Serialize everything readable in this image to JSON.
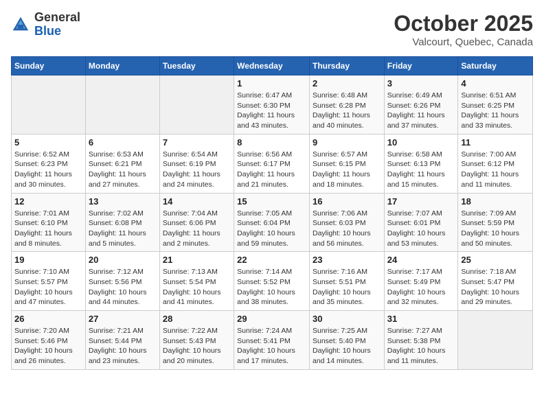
{
  "header": {
    "logo_general": "General",
    "logo_blue": "Blue",
    "month_title": "October 2025",
    "subtitle": "Valcourt, Quebec, Canada"
  },
  "weekdays": [
    "Sunday",
    "Monday",
    "Tuesday",
    "Wednesday",
    "Thursday",
    "Friday",
    "Saturday"
  ],
  "weeks": [
    [
      {
        "day": "",
        "empty": true
      },
      {
        "day": "",
        "empty": true
      },
      {
        "day": "",
        "empty": true
      },
      {
        "day": "1",
        "sunrise": "Sunrise: 6:47 AM",
        "sunset": "Sunset: 6:30 PM",
        "daylight": "Daylight: 11 hours and 43 minutes."
      },
      {
        "day": "2",
        "sunrise": "Sunrise: 6:48 AM",
        "sunset": "Sunset: 6:28 PM",
        "daylight": "Daylight: 11 hours and 40 minutes."
      },
      {
        "day": "3",
        "sunrise": "Sunrise: 6:49 AM",
        "sunset": "Sunset: 6:26 PM",
        "daylight": "Daylight: 11 hours and 37 minutes."
      },
      {
        "day": "4",
        "sunrise": "Sunrise: 6:51 AM",
        "sunset": "Sunset: 6:25 PM",
        "daylight": "Daylight: 11 hours and 33 minutes."
      }
    ],
    [
      {
        "day": "5",
        "sunrise": "Sunrise: 6:52 AM",
        "sunset": "Sunset: 6:23 PM",
        "daylight": "Daylight: 11 hours and 30 minutes."
      },
      {
        "day": "6",
        "sunrise": "Sunrise: 6:53 AM",
        "sunset": "Sunset: 6:21 PM",
        "daylight": "Daylight: 11 hours and 27 minutes."
      },
      {
        "day": "7",
        "sunrise": "Sunrise: 6:54 AM",
        "sunset": "Sunset: 6:19 PM",
        "daylight": "Daylight: 11 hours and 24 minutes."
      },
      {
        "day": "8",
        "sunrise": "Sunrise: 6:56 AM",
        "sunset": "Sunset: 6:17 PM",
        "daylight": "Daylight: 11 hours and 21 minutes."
      },
      {
        "day": "9",
        "sunrise": "Sunrise: 6:57 AM",
        "sunset": "Sunset: 6:15 PM",
        "daylight": "Daylight: 11 hours and 18 minutes."
      },
      {
        "day": "10",
        "sunrise": "Sunrise: 6:58 AM",
        "sunset": "Sunset: 6:13 PM",
        "daylight": "Daylight: 11 hours and 15 minutes."
      },
      {
        "day": "11",
        "sunrise": "Sunrise: 7:00 AM",
        "sunset": "Sunset: 6:12 PM",
        "daylight": "Daylight: 11 hours and 11 minutes."
      }
    ],
    [
      {
        "day": "12",
        "sunrise": "Sunrise: 7:01 AM",
        "sunset": "Sunset: 6:10 PM",
        "daylight": "Daylight: 11 hours and 8 minutes."
      },
      {
        "day": "13",
        "sunrise": "Sunrise: 7:02 AM",
        "sunset": "Sunset: 6:08 PM",
        "daylight": "Daylight: 11 hours and 5 minutes."
      },
      {
        "day": "14",
        "sunrise": "Sunrise: 7:04 AM",
        "sunset": "Sunset: 6:06 PM",
        "daylight": "Daylight: 11 hours and 2 minutes."
      },
      {
        "day": "15",
        "sunrise": "Sunrise: 7:05 AM",
        "sunset": "Sunset: 6:04 PM",
        "daylight": "Daylight: 10 hours and 59 minutes."
      },
      {
        "day": "16",
        "sunrise": "Sunrise: 7:06 AM",
        "sunset": "Sunset: 6:03 PM",
        "daylight": "Daylight: 10 hours and 56 minutes."
      },
      {
        "day": "17",
        "sunrise": "Sunrise: 7:07 AM",
        "sunset": "Sunset: 6:01 PM",
        "daylight": "Daylight: 10 hours and 53 minutes."
      },
      {
        "day": "18",
        "sunrise": "Sunrise: 7:09 AM",
        "sunset": "Sunset: 5:59 PM",
        "daylight": "Daylight: 10 hours and 50 minutes."
      }
    ],
    [
      {
        "day": "19",
        "sunrise": "Sunrise: 7:10 AM",
        "sunset": "Sunset: 5:57 PM",
        "daylight": "Daylight: 10 hours and 47 minutes."
      },
      {
        "day": "20",
        "sunrise": "Sunrise: 7:12 AM",
        "sunset": "Sunset: 5:56 PM",
        "daylight": "Daylight: 10 hours and 44 minutes."
      },
      {
        "day": "21",
        "sunrise": "Sunrise: 7:13 AM",
        "sunset": "Sunset: 5:54 PM",
        "daylight": "Daylight: 10 hours and 41 minutes."
      },
      {
        "day": "22",
        "sunrise": "Sunrise: 7:14 AM",
        "sunset": "Sunset: 5:52 PM",
        "daylight": "Daylight: 10 hours and 38 minutes."
      },
      {
        "day": "23",
        "sunrise": "Sunrise: 7:16 AM",
        "sunset": "Sunset: 5:51 PM",
        "daylight": "Daylight: 10 hours and 35 minutes."
      },
      {
        "day": "24",
        "sunrise": "Sunrise: 7:17 AM",
        "sunset": "Sunset: 5:49 PM",
        "daylight": "Daylight: 10 hours and 32 minutes."
      },
      {
        "day": "25",
        "sunrise": "Sunrise: 7:18 AM",
        "sunset": "Sunset: 5:47 PM",
        "daylight": "Daylight: 10 hours and 29 minutes."
      }
    ],
    [
      {
        "day": "26",
        "sunrise": "Sunrise: 7:20 AM",
        "sunset": "Sunset: 5:46 PM",
        "daylight": "Daylight: 10 hours and 26 minutes."
      },
      {
        "day": "27",
        "sunrise": "Sunrise: 7:21 AM",
        "sunset": "Sunset: 5:44 PM",
        "daylight": "Daylight: 10 hours and 23 minutes."
      },
      {
        "day": "28",
        "sunrise": "Sunrise: 7:22 AM",
        "sunset": "Sunset: 5:43 PM",
        "daylight": "Daylight: 10 hours and 20 minutes."
      },
      {
        "day": "29",
        "sunrise": "Sunrise: 7:24 AM",
        "sunset": "Sunset: 5:41 PM",
        "daylight": "Daylight: 10 hours and 17 minutes."
      },
      {
        "day": "30",
        "sunrise": "Sunrise: 7:25 AM",
        "sunset": "Sunset: 5:40 PM",
        "daylight": "Daylight: 10 hours and 14 minutes."
      },
      {
        "day": "31",
        "sunrise": "Sunrise: 7:27 AM",
        "sunset": "Sunset: 5:38 PM",
        "daylight": "Daylight: 10 hours and 11 minutes."
      },
      {
        "day": "",
        "empty": true
      }
    ]
  ]
}
